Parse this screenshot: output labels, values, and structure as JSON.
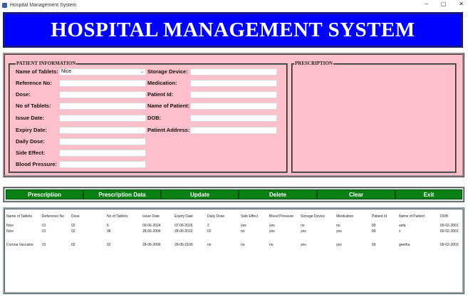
{
  "window": {
    "title": "Hospital Management System",
    "minimize": "–",
    "maximize": "▢",
    "close": "✕"
  },
  "header": {
    "title": "HOSPITAL MANAGEMENT SYSTEM"
  },
  "patient_info": {
    "legend": "PATIENT INFORMATION",
    "name_of_tablets": {
      "label": "Name of Tablets:",
      "value": "Nice",
      "arrow": "⌄"
    },
    "reference_no": {
      "label": "Reference No:",
      "value": ""
    },
    "dose": {
      "label": "Dose:",
      "value": ""
    },
    "no_of_tablets": {
      "label": "No of Tablets:",
      "value": ""
    },
    "issue_date": {
      "label": "Issue Date:",
      "value": ""
    },
    "expiry_date": {
      "label": "Expiry Date:",
      "value": ""
    },
    "daily_dose": {
      "label": "Daily Dose:",
      "value": ""
    },
    "side_effect": {
      "label": "Side Effect:",
      "value": ""
    },
    "blood_pressure": {
      "label": "Blood Pressure:",
      "value": ""
    },
    "storage_device": {
      "label": "Storage Device:",
      "value": ""
    },
    "medication": {
      "label": "Medication:",
      "value": ""
    },
    "patient_id": {
      "label": "Patient Id:",
      "value": ""
    },
    "name_of_patient": {
      "label": "Name of Patient:",
      "value": ""
    },
    "dob": {
      "label": "DOB:",
      "value": ""
    },
    "patient_address": {
      "label": "Patient Address:",
      "value": ""
    }
  },
  "prescription": {
    "legend": "PRESCRIPTION"
  },
  "buttons": {
    "prescription": "Prescription",
    "prescription_data": "Prescription Data",
    "update": "Update",
    "delete": "Delete",
    "clear": "Clear",
    "exit": "Exit"
  },
  "table": {
    "columns": [
      "Name of Tablets",
      "Reference No",
      "Dose",
      "No of Tablets",
      "Issue Date",
      "Expiry Date",
      "Daily Dose",
      "Side Effect",
      "Blood Pressure",
      "Storage Device",
      "Medication",
      "Patient Id",
      "Name of Patient",
      "DOB"
    ],
    "rows": [
      [
        "Nice",
        "01",
        "02",
        "6",
        "09-06-2024",
        "07-06-2026",
        "2",
        "yes",
        "yes",
        "no",
        "no",
        "09",
        "asfa",
        "09-02-2001"
      ],
      [
        "Nice",
        "01",
        "02",
        "98",
        "28-06-2006",
        "28-06-2010",
        "02",
        "no",
        "yes",
        "yes",
        "yes",
        "09",
        "c",
        "09-02-2001"
      ],
      [
        "Corona Vaccaine",
        "01",
        "02",
        "02",
        "28-06-2006",
        "28-06-2109",
        "no",
        "no",
        "no",
        "yes",
        "yes",
        "09",
        "geetha",
        "09-02-2003"
      ]
    ]
  }
}
